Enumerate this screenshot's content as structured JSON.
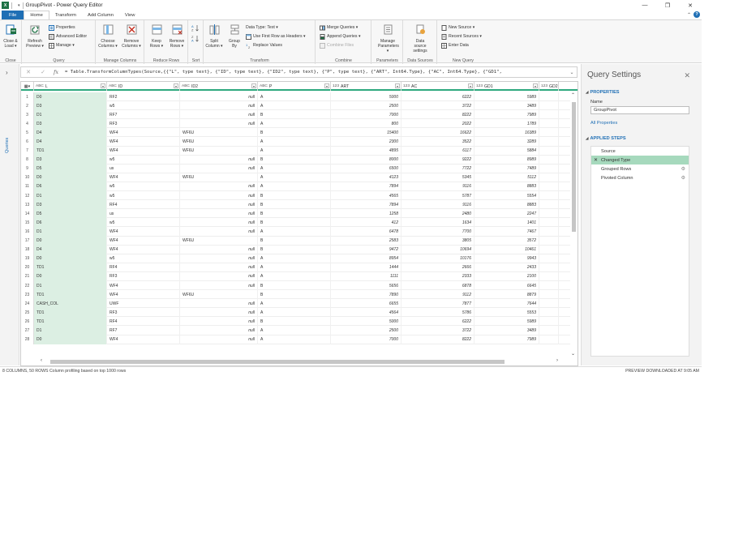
{
  "window": {
    "title": "GroupPivot - Power Query Editor",
    "app_icon": "X",
    "accent": "#1f6fb5",
    "excel_green": "#1e7145"
  },
  "menu": {
    "file": "File",
    "tabs": [
      "Home",
      "Transform",
      "Add Column",
      "View"
    ],
    "active_tab": "Home"
  },
  "ribbon": {
    "close": {
      "label": "Close",
      "close_load": "Close &",
      "close_load2": "Load"
    },
    "query": {
      "label": "Query",
      "refresh": "Refresh",
      "refresh2": "Preview",
      "properties": "Properties",
      "advanced_editor": "Advanced Editor",
      "manage": "Manage"
    },
    "manage_columns": {
      "label": "Manage Columns",
      "choose": "Choose",
      "choose2": "Columns",
      "remove": "Remove",
      "remove2": "Columns"
    },
    "reduce_rows": {
      "label": "Reduce Rows",
      "keep": "Keep",
      "keep2": "Rows",
      "remove": "Remove",
      "remove2": "Rows"
    },
    "sort": {
      "label": "Sort"
    },
    "transform": {
      "label": "Transform",
      "split": "Split",
      "split2": "Column",
      "group": "Group",
      "group2": "By",
      "data_type": "Data Type: Text",
      "first_row": "Use First Row as Headers",
      "replace": "Replace Values"
    },
    "combine": {
      "label": "Combine",
      "merge": "Merge Queries",
      "append": "Append Queries",
      "combine_files": "Combine Files"
    },
    "parameters": {
      "label": "Parameters",
      "manage": "Manage",
      "manage2": "Parameters"
    },
    "data_sources": {
      "label": "Data Sources",
      "settings": "Data source",
      "settings2": "settings"
    },
    "new_query": {
      "label": "New Query",
      "new_source": "New Source",
      "recent": "Recent Sources",
      "enter": "Enter Data"
    }
  },
  "queries_label": "Queries",
  "formula": {
    "fx": "fx",
    "text": "= Table.TransformColumnTypes(Source,{{\"L\", type text}, {\"ID\", type text}, {\"ID2\", type text}, {\"P\", type text}, {\"ART\", Int64.Type}, {\"AC\", Int64.Type}, {\"GD1\","
  },
  "grid": {
    "columns": [
      {
        "name": "L",
        "type": "ABC"
      },
      {
        "name": "ID",
        "type": "ABC"
      },
      {
        "name": "ID2",
        "type": "ABC"
      },
      {
        "name": "P",
        "type": "ABC"
      },
      {
        "name": "ART",
        "type": "123"
      },
      {
        "name": "AC",
        "type": "123"
      },
      {
        "name": "GD1",
        "type": "123"
      },
      {
        "name": "GD2",
        "type": "123"
      }
    ],
    "rows": [
      [
        "1",
        "D0",
        "RF2",
        "null",
        "A",
        "5000",
        "6222",
        "5989"
      ],
      [
        "2",
        "D3",
        "w5",
        "null",
        "A",
        "2500",
        "3722",
        "3489"
      ],
      [
        "3",
        "D1",
        "RF7",
        "null",
        "B",
        "7000",
        "8222",
        "7989"
      ],
      [
        "4",
        "D3",
        "RF3",
        "null",
        "A",
        "800",
        "2022",
        "1789"
      ],
      [
        "5",
        "D4",
        "WF4",
        "WF6U",
        "B",
        "15400",
        "16622",
        "16389"
      ],
      [
        "6",
        "D4",
        "WF4",
        "WF6U",
        "A",
        "2300",
        "3522",
        "3289"
      ],
      [
        "7",
        "TD1",
        "WF4",
        "WF6U",
        "A",
        "4895",
        "6117",
        "5884"
      ],
      [
        "8",
        "D3",
        "w5",
        "null",
        "B",
        "8000",
        "9222",
        "8989"
      ],
      [
        "9",
        "D5",
        "us",
        "null",
        "A",
        "6500",
        "7722",
        "7489"
      ],
      [
        "10",
        "D0",
        "WF4",
        "WF6U",
        "A",
        "4123",
        "5345",
        "5112"
      ],
      [
        "11",
        "D6",
        "w5",
        "null",
        "A",
        "7894",
        "9116",
        "8883"
      ],
      [
        "12",
        "D1",
        "w5",
        "null",
        "B",
        "4565",
        "5787",
        "5554"
      ],
      [
        "13",
        "D3",
        "RF4",
        "null",
        "B",
        "7894",
        "9116",
        "8883"
      ],
      [
        "14",
        "D5",
        "us",
        "null",
        "B",
        "1258",
        "2480",
        "2247"
      ],
      [
        "15",
        "D6",
        "w5",
        "null",
        "B",
        "412",
        "1634",
        "1401"
      ],
      [
        "16",
        "D1",
        "WF4",
        "null",
        "A",
        "6478",
        "7700",
        "7467"
      ],
      [
        "17",
        "D0",
        "WF4",
        "WF6U",
        "B",
        "2583",
        "3805",
        "3572"
      ],
      [
        "18",
        "D4",
        "WF4",
        "null",
        "B",
        "9472",
        "10694",
        "10461"
      ],
      [
        "19",
        "D0",
        "w5",
        "null",
        "A",
        "8954",
        "10176",
        "9943"
      ],
      [
        "20",
        "TD1",
        "RF4",
        "null",
        "A",
        "1444",
        "2666",
        "2433"
      ],
      [
        "21",
        "D0",
        "RF3",
        "null",
        "A",
        "1111",
        "2333",
        "2100"
      ],
      [
        "22",
        "D1",
        "WF4",
        "null",
        "B",
        "5656",
        "6878",
        "6645"
      ],
      [
        "23",
        "TD1",
        "WF4",
        "WF6U",
        "B",
        "7890",
        "9112",
        "8879"
      ],
      [
        "24",
        "CASH_COL",
        "UWF",
        "null",
        "A",
        "6655",
        "7877",
        "7644"
      ],
      [
        "25",
        "TD1",
        "RF3",
        "null",
        "A",
        "4564",
        "5786",
        "5553"
      ],
      [
        "26",
        "TD1",
        "RF4",
        "null",
        "B",
        "5000",
        "6222",
        "5989"
      ],
      [
        "27",
        "D1",
        "RF7",
        "null",
        "A",
        "2500",
        "3722",
        "3489"
      ],
      [
        "28",
        "D0",
        "WF4",
        "null",
        "A",
        "7000",
        "8222",
        "7989"
      ]
    ]
  },
  "settings": {
    "title": "Query Settings",
    "properties_title": "PROPERTIES",
    "name_label": "Name",
    "name_value": "GroupPivot",
    "all_properties": "All Properties",
    "steps_title": "APPLIED STEPS",
    "steps": [
      {
        "label": "Source",
        "active": false,
        "gear": false
      },
      {
        "label": "Changed Type",
        "active": true,
        "gear": false
      },
      {
        "label": "Grouped Rows",
        "active": false,
        "gear": true
      },
      {
        "label": "Pivoted Column",
        "active": false,
        "gear": true
      }
    ]
  },
  "status": {
    "left": "8 COLUMNS, 50 ROWS    Column profiling based on top 1000 rows",
    "right": "PREVIEW DOWNLOADED AT 9:05 AM"
  }
}
